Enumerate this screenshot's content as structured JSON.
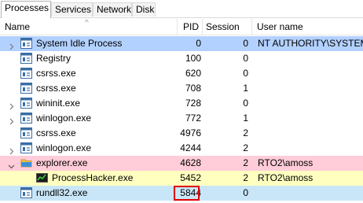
{
  "tabs": [
    {
      "label": "Processes",
      "active": true
    },
    {
      "label": "Services",
      "active": false
    },
    {
      "label": "Network",
      "active": false
    },
    {
      "label": "Disk",
      "active": false
    }
  ],
  "columns": {
    "name": "Name",
    "pid": "PID",
    "session": "Session ID",
    "user": "User name",
    "sort_indicator": "^"
  },
  "processes": [
    {
      "name": "System Idle Process",
      "pid": "0",
      "session": "0",
      "user": "NT AUTHORITY\\SYSTEM",
      "depth": 0,
      "expander": "collapsed",
      "icon": "window-process-icon",
      "bg": "#b3d1ff"
    },
    {
      "name": "Registry",
      "pid": "100",
      "session": "0",
      "user": "",
      "depth": 0,
      "expander": "none",
      "icon": "window-process-icon",
      "bg": ""
    },
    {
      "name": "csrss.exe",
      "pid": "620",
      "session": "0",
      "user": "",
      "depth": 0,
      "expander": "none",
      "icon": "window-process-icon",
      "bg": ""
    },
    {
      "name": "csrss.exe",
      "pid": "708",
      "session": "1",
      "user": "",
      "depth": 0,
      "expander": "none",
      "icon": "window-process-icon",
      "bg": ""
    },
    {
      "name": "wininit.exe",
      "pid": "728",
      "session": "0",
      "user": "",
      "depth": 0,
      "expander": "collapsed",
      "icon": "window-process-icon",
      "bg": ""
    },
    {
      "name": "winlogon.exe",
      "pid": "772",
      "session": "1",
      "user": "",
      "depth": 0,
      "expander": "collapsed",
      "icon": "window-process-icon",
      "bg": ""
    },
    {
      "name": "csrss.exe",
      "pid": "4976",
      "session": "2",
      "user": "",
      "depth": 0,
      "expander": "none",
      "icon": "window-process-icon",
      "bg": ""
    },
    {
      "name": "winlogon.exe",
      "pid": "4244",
      "session": "2",
      "user": "",
      "depth": 0,
      "expander": "collapsed",
      "icon": "window-process-icon",
      "bg": ""
    },
    {
      "name": "explorer.exe",
      "pid": "4628",
      "session": "2",
      "user": "RTO2\\amoss",
      "depth": 0,
      "expander": "expanded",
      "icon": "folder-icon",
      "bg": "#ffccd9"
    },
    {
      "name": "ProcessHacker.exe",
      "pid": "5452",
      "session": "2",
      "user": "RTO2\\amoss",
      "depth": 1,
      "expander": "none",
      "icon": "process-hacker-icon",
      "bg": "#ffffc0"
    },
    {
      "name": "rundll32.exe",
      "pid": "5844",
      "session": "0",
      "user": "",
      "depth": 0,
      "expander": "none",
      "icon": "window-process-icon",
      "bg": "#c9e6f8",
      "pid_highlighted": true
    }
  ],
  "colors": {
    "system_highlight": "#b3d1ff",
    "user_process": "#ffccd9",
    "own_process": "#ffffc0",
    "service_process": "#c9e6f8",
    "pid_box": "#e00000"
  }
}
